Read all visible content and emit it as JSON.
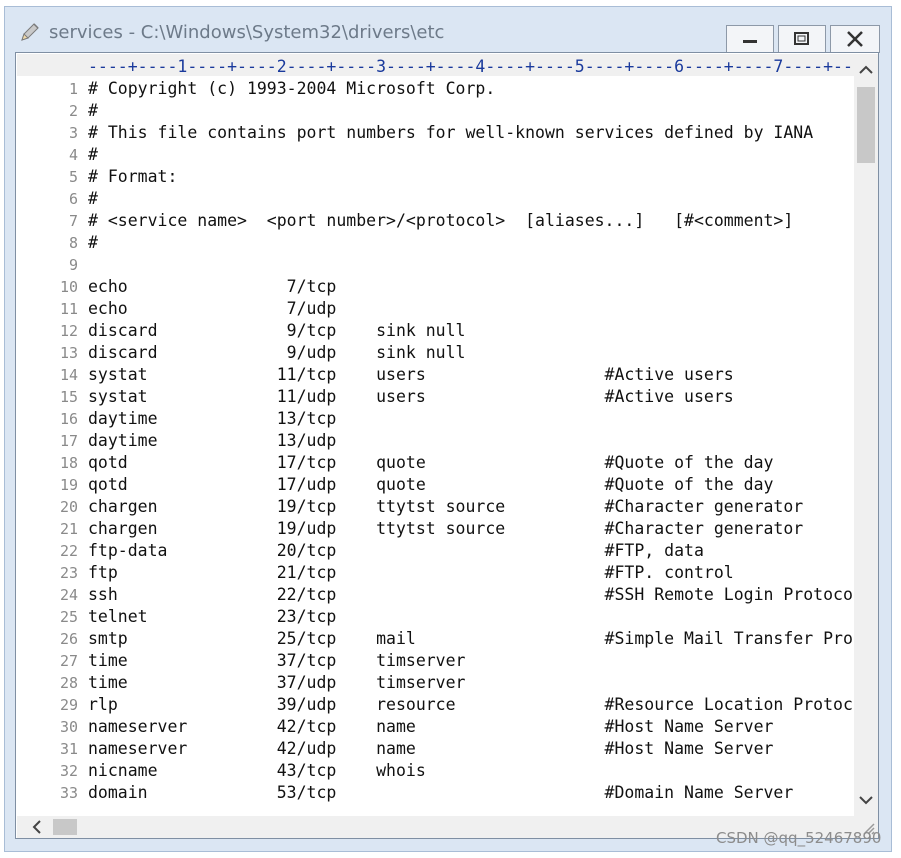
{
  "window": {
    "title": "services - C:\\Windows\\System32\\drivers\\etc",
    "icon": "notepad-pencil-icon"
  },
  "controls": {
    "minimize": "minimize-icon",
    "maximize": "maximize-icon",
    "close": "close-icon"
  },
  "ruler": "----+----1----+----2----+----3----+----4----+----5----+----6----+----7----+---",
  "lines": [
    {
      "n": "1",
      "text": "# Copyright (c) 1993-2004 Microsoft Corp."
    },
    {
      "n": "2",
      "text": "#"
    },
    {
      "n": "3",
      "text": "# This file contains port numbers for well-known services defined by IANA"
    },
    {
      "n": "4",
      "text": "#"
    },
    {
      "n": "5",
      "text": "# Format:"
    },
    {
      "n": "6",
      "text": "#"
    },
    {
      "n": "7",
      "text": "# <service name>  <port number>/<protocol>  [aliases...]   [#<comment>]"
    },
    {
      "n": "8",
      "text": "#"
    },
    {
      "n": "9",
      "text": ""
    },
    {
      "n": "10",
      "text": "echo                7/tcp"
    },
    {
      "n": "11",
      "text": "echo                7/udp"
    },
    {
      "n": "12",
      "text": "discard             9/tcp    sink null"
    },
    {
      "n": "13",
      "text": "discard             9/udp    sink null"
    },
    {
      "n": "14",
      "text": "systat             11/tcp    users                  #Active users"
    },
    {
      "n": "15",
      "text": "systat             11/udp    users                  #Active users"
    },
    {
      "n": "16",
      "text": "daytime            13/tcp"
    },
    {
      "n": "17",
      "text": "daytime            13/udp"
    },
    {
      "n": "18",
      "text": "qotd               17/tcp    quote                  #Quote of the day"
    },
    {
      "n": "19",
      "text": "qotd               17/udp    quote                  #Quote of the day"
    },
    {
      "n": "20",
      "text": "chargen            19/tcp    ttytst source          #Character generator"
    },
    {
      "n": "21",
      "text": "chargen            19/udp    ttytst source          #Character generator"
    },
    {
      "n": "22",
      "text": "ftp-data           20/tcp                           #FTP, data"
    },
    {
      "n": "23",
      "text": "ftp                21/tcp                           #FTP. control"
    },
    {
      "n": "24",
      "text": "ssh                22/tcp                           #SSH Remote Login Protoco"
    },
    {
      "n": "25",
      "text": "telnet             23/tcp"
    },
    {
      "n": "26",
      "text": "smtp               25/tcp    mail                   #Simple Mail Transfer Pro"
    },
    {
      "n": "27",
      "text": "time               37/tcp    timserver"
    },
    {
      "n": "28",
      "text": "time               37/udp    timserver"
    },
    {
      "n": "29",
      "text": "rlp                39/udp    resource               #Resource Location Protoc"
    },
    {
      "n": "30",
      "text": "nameserver         42/tcp    name                   #Host Name Server"
    },
    {
      "n": "31",
      "text": "nameserver         42/udp    name                   #Host Name Server"
    },
    {
      "n": "32",
      "text": "nicname            43/tcp    whois"
    },
    {
      "n": "33",
      "text": "domain             53/tcp                           #Domain Name Server"
    }
  ],
  "watermark": "CSDN @qq_52467890",
  "colors": {
    "frame": "#dbe6f3",
    "ruler_text": "#1a3a9c",
    "line_numbers": "#8a8a8a",
    "text": "#111111"
  }
}
